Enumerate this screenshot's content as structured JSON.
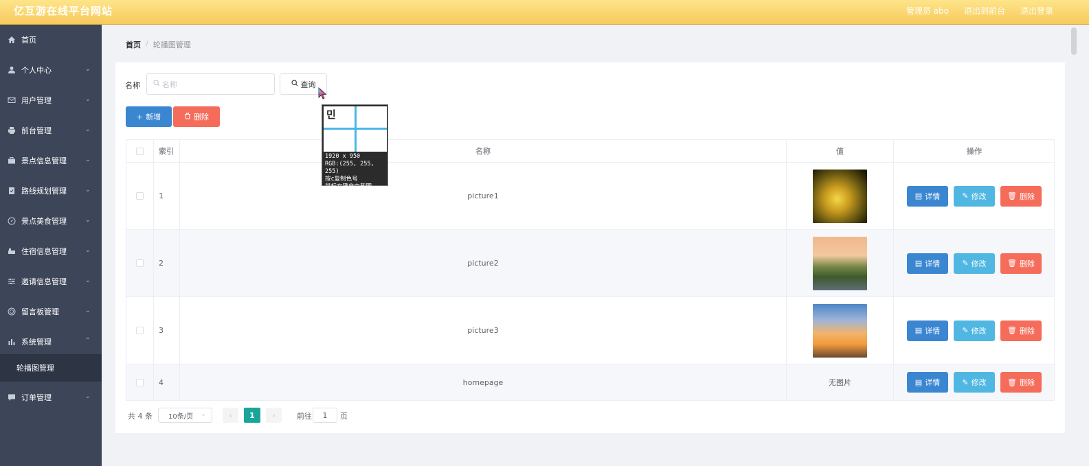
{
  "header": {
    "brand": "亿互游在线平台网站",
    "user": "管理员 abo",
    "front_link": "退出到前台",
    "logout_link": "退出登录"
  },
  "sidebar": {
    "items": [
      {
        "label": "首页",
        "icon": "home-icon"
      },
      {
        "label": "个人中心",
        "icon": "user-icon"
      },
      {
        "label": "用户管理",
        "icon": "mail-icon"
      },
      {
        "label": "前台管理",
        "icon": "printer-icon"
      },
      {
        "label": "景点信息管理",
        "icon": "briefcase-icon"
      },
      {
        "label": "路线规划管理",
        "icon": "checklist-icon"
      },
      {
        "label": "景点美食管理",
        "icon": "compass-icon"
      },
      {
        "label": "住宿信息管理",
        "icon": "hotel-icon"
      },
      {
        "label": "邀请信息管理",
        "icon": "sliders-icon"
      },
      {
        "label": "留言板管理",
        "icon": "target-icon"
      },
      {
        "label": "系统管理",
        "icon": "chart-icon"
      },
      {
        "label": "订单管理",
        "icon": "chat-icon"
      }
    ],
    "submenu": {
      "label": "轮播图管理"
    }
  },
  "breadcrumb": {
    "home": "首页",
    "separator": "/",
    "current": "轮播图管理"
  },
  "search": {
    "label": "名称",
    "placeholder": "名称",
    "value": "",
    "query_label": "查询"
  },
  "toolbar": {
    "add_label": "新增",
    "delete_label": "删除"
  },
  "table": {
    "columns": {
      "index": "索引",
      "name": "名称",
      "value": "值",
      "ops": "操作"
    },
    "rows": [
      {
        "index": "1",
        "name": "picture1",
        "value": "",
        "image": "thumb-golden"
      },
      {
        "index": "2",
        "name": "picture2",
        "value": "",
        "image": "thumb-garden"
      },
      {
        "index": "3",
        "name": "picture3",
        "value": "",
        "image": "thumb-sunset"
      },
      {
        "index": "4",
        "name": "homepage",
        "value": "无图片",
        "image": ""
      }
    ],
    "ops": {
      "detail": "详情",
      "edit": "修改",
      "delete": "删除"
    }
  },
  "pagination": {
    "total": "共 4 条",
    "page_size": "10条/页",
    "current_page": "1",
    "goto_label": "前往",
    "goto_value": "1",
    "unit": "页"
  },
  "picker": {
    "glyph": "민",
    "size": "1920 x 950",
    "rgb": "RGB:(255, 255, 255)",
    "hint1": "按c复制色号",
    "hint2": "鼠标右键自由截图"
  },
  "colors": {
    "header": "#f7c95b",
    "sidebar": "#3d4558",
    "primary": "#3a86d1",
    "danger": "#f56c5b",
    "info": "#50b6e2",
    "page_active": "#1aa59a"
  }
}
